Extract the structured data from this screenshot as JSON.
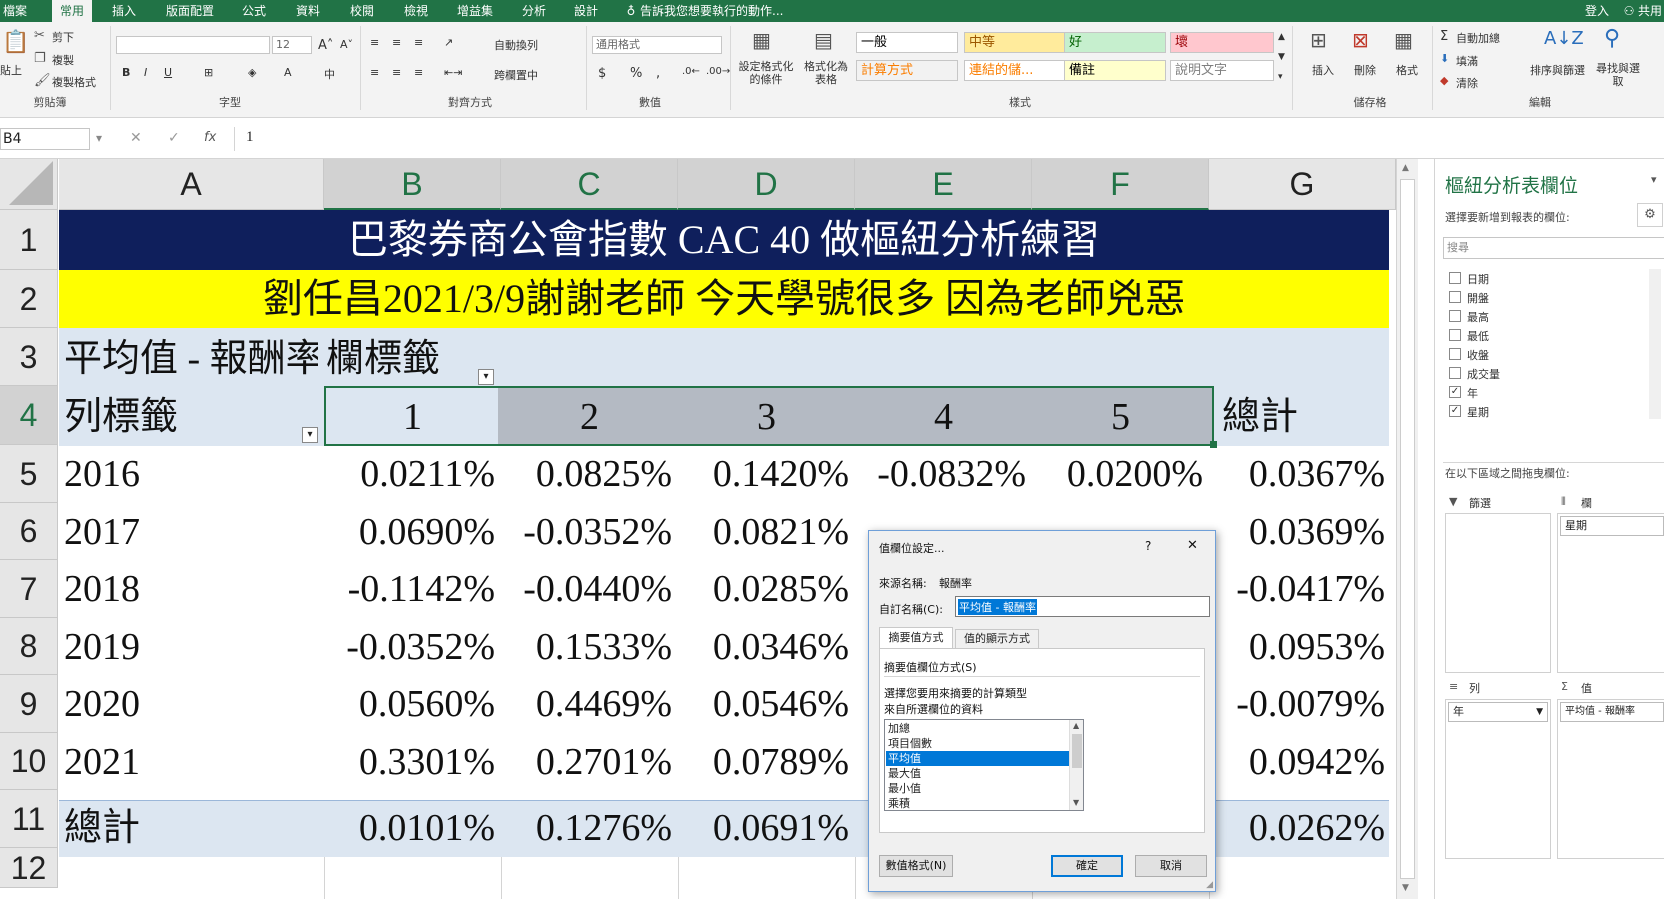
{
  "ribbon": {
    "tabs": [
      "檔案",
      "常用",
      "插入",
      "版面配置",
      "公式",
      "資料",
      "校閱",
      "檢視",
      "增益集",
      "分析",
      "設計"
    ],
    "active_tab": "常用",
    "tell_me": "告訴我您想要執行的動作...",
    "login": "登入",
    "share": "共用",
    "clipboard": {
      "paste": "貼上",
      "cut": "剪下",
      "copy": "複製",
      "format_painter": "複製格式",
      "group": "剪貼簿"
    },
    "font": {
      "size": "12",
      "group": "字型"
    },
    "alignment": {
      "wrap": "自動換列",
      "merge": "跨欄置中",
      "group": "對齊方式"
    },
    "number": {
      "format": "通用格式",
      "group": "數值"
    },
    "styles": {
      "conditional": "設定格式化的條件",
      "table": "格式化為表格",
      "group": "樣式",
      "cells": [
        {
          "label": "一般",
          "bg": "#ffffff",
          "color": "#000000"
        },
        {
          "label": "中等",
          "bg": "#ffeb9c",
          "color": "#9c5700"
        },
        {
          "label": "好",
          "bg": "#c6efce",
          "color": "#006100"
        },
        {
          "label": "壞",
          "bg": "#ffc7ce",
          "color": "#9c0006"
        },
        {
          "label": "計算方式",
          "bg": "#f2f2f2",
          "color": "#fa7d00"
        },
        {
          "label": "連結的儲...",
          "bg": "#ffffff",
          "color": "#fa7d00"
        },
        {
          "label": "備註",
          "bg": "#ffffcc",
          "color": "#000000"
        },
        {
          "label": "說明文字",
          "bg": "#ffffff",
          "color": "#7f7f7f"
        }
      ]
    },
    "cells_group": {
      "insert": "插入",
      "delete": "刪除",
      "format": "格式",
      "group": "儲存格"
    },
    "editing": {
      "autosum": "自動加總",
      "fill": "填滿",
      "clear": "清除",
      "sort": "排序與篩選",
      "find": "尋找與選取",
      "group": "編輯"
    }
  },
  "formula_bar": {
    "name_box": "B4",
    "fx": "fx",
    "value": "1"
  },
  "grid": {
    "columns": [
      "A",
      "B",
      "C",
      "D",
      "E",
      "F",
      "G"
    ],
    "rows": [
      "1",
      "2",
      "3",
      "4",
      "5",
      "6",
      "7",
      "8",
      "9",
      "10",
      "11",
      "12"
    ],
    "title": "巴黎券商公會指數 CAC 40 做樞紐分析練習",
    "subtitle": "劉任昌2021/3/9謝謝老師 今天學號很多 因為老師兇惡",
    "value_label": "平均值 - 報酬率",
    "col_labels": "欄標籤",
    "row_labels": "列標籤",
    "grand_total": "總計",
    "col_keys": [
      "1",
      "2",
      "3",
      "4",
      "5"
    ],
    "data_rows": [
      {
        "year": "2016",
        "vals": [
          "0.0211%",
          "0.0825%",
          "0.1420%",
          "-0.0832%",
          "0.0200%"
        ],
        "total": "0.0367%"
      },
      {
        "year": "2017",
        "vals": [
          "0.0690%",
          "-0.0352%",
          "0.0821%",
          "",
          ""
        ],
        "total": "0.0369%"
      },
      {
        "year": "2018",
        "vals": [
          "-0.1142%",
          "-0.0440%",
          "0.0285%",
          "",
          ""
        ],
        "total": "-0.0417%"
      },
      {
        "year": "2019",
        "vals": [
          "-0.0352%",
          "0.1533%",
          "0.0346%",
          "",
          ""
        ],
        "total": "0.0953%"
      },
      {
        "year": "2020",
        "vals": [
          "0.0560%",
          "0.4469%",
          "0.0546%",
          "",
          ""
        ],
        "total": "-0.0079%"
      },
      {
        "year": "2021",
        "vals": [
          "0.3301%",
          "0.2701%",
          "0.0789%",
          "",
          ""
        ],
        "total": "0.0942%"
      }
    ],
    "total_row": {
      "label": "總計",
      "vals": [
        "0.0101%",
        "0.1276%",
        "0.0691%"
      ],
      "total": "0.0262%"
    }
  },
  "dialog": {
    "title": "值欄位設定...",
    "help": "?",
    "close": "✕",
    "source_label": "來源名稱:",
    "source_value": "報酬率",
    "custom_label": "自訂名稱(C):",
    "custom_value": "平均值 - 報酬率",
    "tabs": [
      "摘要值方式",
      "值的顯示方式"
    ],
    "section": "摘要值欄位方式(S)",
    "desc1": "選擇您要用來摘要的計算類型",
    "desc2": "來自所選欄位的資料",
    "list": [
      "加總",
      "項目個數",
      "平均值",
      "最大值",
      "最小值",
      "乘積"
    ],
    "selected": "平均值",
    "number_format": "數值格式(N)",
    "ok": "確定",
    "cancel": "取消"
  },
  "pivot_pane": {
    "title": "樞紐分析表欄位",
    "subtitle": "選擇要新增到報表的欄位:",
    "search": "搜尋",
    "fields": [
      {
        "name": "日期",
        "checked": false
      },
      {
        "name": "開盤",
        "checked": false
      },
      {
        "name": "最高",
        "checked": false
      },
      {
        "name": "最低",
        "checked": false
      },
      {
        "name": "收盤",
        "checked": false
      },
      {
        "name": "成交量",
        "checked": false
      },
      {
        "name": "年",
        "checked": true
      },
      {
        "name": "星期",
        "checked": true
      }
    ],
    "drag_hint": "在以下區域之間拖曳欄位:",
    "filters": "篩選",
    "columns": "欄",
    "rows": "列",
    "values": "值",
    "col_field": "星期",
    "row_field": "年",
    "val_field": "平均值 - 報酬率"
  }
}
